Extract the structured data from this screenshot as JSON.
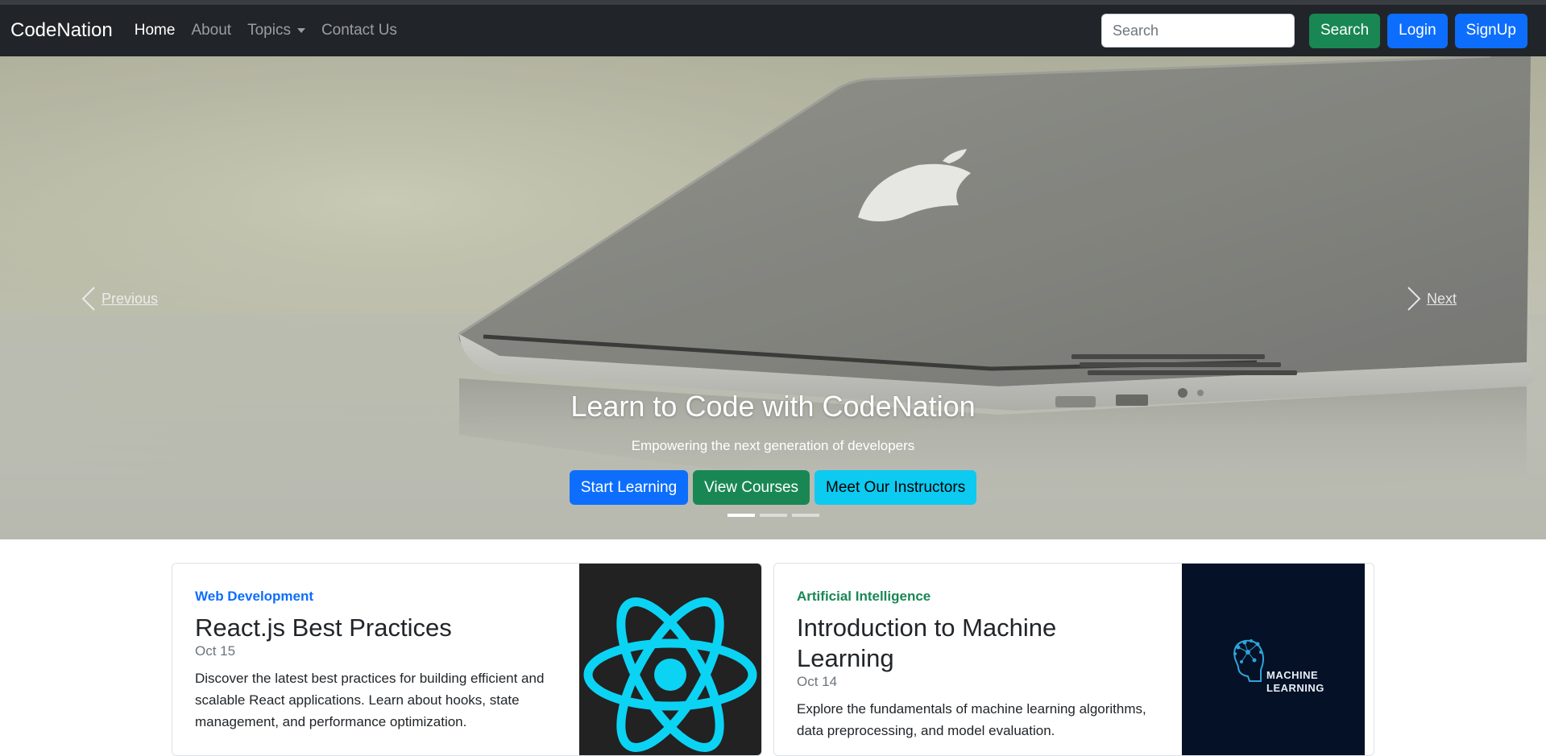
{
  "navbar": {
    "brand": "CodeNation",
    "links": [
      {
        "label": "Home",
        "active": true
      },
      {
        "label": "About",
        "active": false
      },
      {
        "label": "Topics",
        "active": false,
        "dropdown": true
      },
      {
        "label": "Contact Us",
        "active": false
      }
    ],
    "search_placeholder": "Search",
    "search_button": "Search",
    "login_button": "Login",
    "signup_button": "SignUp"
  },
  "hero": {
    "prev_label": "Previous",
    "next_label": "Next",
    "title": "Learn to Code with CodeNation",
    "subtitle": "Empowering the next generation of developers",
    "buttons": [
      "Start Learning",
      "View Courses",
      "Meet Our Instructors"
    ],
    "slide_count": 3,
    "active_slide": 1
  },
  "cards": [
    {
      "category": "Web Development",
      "title": "React.js Best Practices",
      "date": "Oct 15",
      "text": "Discover the latest best practices for building efficient and scalable React applications. Learn about hooks, state management, and performance optimization.",
      "image_icon": "react-logo-icon"
    },
    {
      "category": "Artificial Intelligence",
      "title": "Introduction to Machine Learning",
      "date": "Oct 14",
      "text": "Explore the fundamentals of machine learning algorithms, data preprocessing, and model evaluation.",
      "image_icon": "machine-learning-logo-icon",
      "image_text_line1": "MACHINE",
      "image_text_line2": "LEARNING"
    }
  ],
  "colors": {
    "navbar_bg": "#212529",
    "primary": "#0d6efd",
    "success": "#198754",
    "info": "#0dcaf0",
    "react_cyan": "#0bd3f4"
  }
}
